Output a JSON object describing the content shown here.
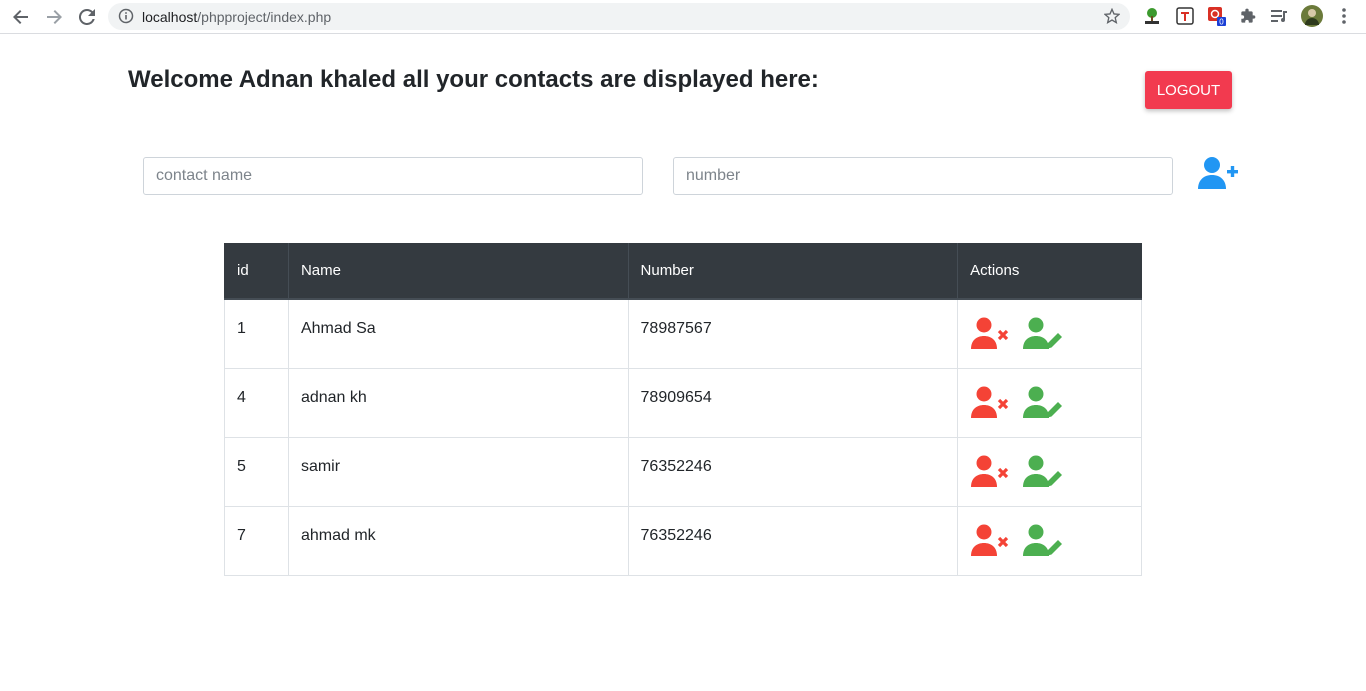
{
  "browser": {
    "url_host": "localhost",
    "url_path": "/phpproject/index.php",
    "icons": [
      "back-icon",
      "forward-icon",
      "reload-icon",
      "info-icon",
      "star-icon",
      "extensions-icon",
      "media-icon",
      "menu-icon"
    ],
    "extension_badge": "0"
  },
  "header": {
    "welcome": "Welcome Adnan khaled all your contacts are displayed here:",
    "logout_label": "LOGOUT"
  },
  "form": {
    "name_placeholder": "contact name",
    "number_placeholder": "number",
    "add_icon": "user-plus-icon"
  },
  "table": {
    "columns": [
      "id",
      "Name",
      "Number",
      "Actions"
    ],
    "rows": [
      {
        "id": "1",
        "name": "Ahmad Sa",
        "number": "78987567"
      },
      {
        "id": "4",
        "name": "adnan kh",
        "number": "78909654"
      },
      {
        "id": "5",
        "name": "samir",
        "number": "76352246"
      },
      {
        "id": "7",
        "name": "ahmad mk",
        "number": "76352246"
      }
    ],
    "action_icons": [
      "user-delete-icon",
      "user-edit-icon"
    ]
  },
  "colors": {
    "logout": "#f23a4f",
    "add": "#2196f3",
    "delete": "#f44336",
    "edit": "#4caf50",
    "table_header": "#343a40"
  }
}
